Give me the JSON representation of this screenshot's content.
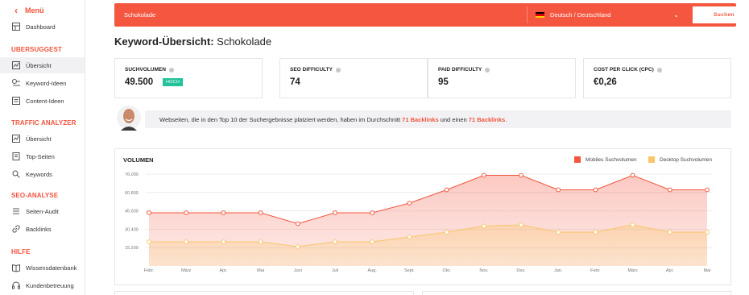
{
  "sidebar": {
    "back_label": "Menü",
    "items_top": [
      {
        "label": "Dashboard",
        "icon": "dashboard-icon"
      }
    ],
    "sections": [
      {
        "title": "UBERSUGGEST",
        "items": [
          {
            "label": "Übersicht",
            "icon": "overview-icon",
            "active": true
          },
          {
            "label": "Keyword-Ideen",
            "icon": "keyword-ideas-icon"
          },
          {
            "label": "Content-Ideen",
            "icon": "content-ideas-icon"
          }
        ]
      },
      {
        "title": "TRAFFIC ANALYZER",
        "items": [
          {
            "label": "Übersicht",
            "icon": "overview-icon"
          },
          {
            "label": "Top-Seiten",
            "icon": "top-pages-icon"
          },
          {
            "label": "Keywords",
            "icon": "keywords-icon"
          }
        ]
      },
      {
        "title": "SEO-ANALYSE",
        "items": [
          {
            "label": "Seiten-Audit",
            "icon": "site-audit-icon"
          },
          {
            "label": "Backlinks",
            "icon": "backlinks-icon"
          }
        ]
      },
      {
        "title": "HILFE",
        "items": [
          {
            "label": "Wissensdatenbank",
            "icon": "knowledge-base-icon"
          },
          {
            "label": "Kundenbetreuung",
            "icon": "support-icon"
          }
        ]
      }
    ]
  },
  "search": {
    "value": "Schokolade",
    "language": "Deutsch / Deutschland",
    "button": "Suchen"
  },
  "page": {
    "title_prefix": "Keyword-Übersicht:",
    "title_keyword": "Schokolade"
  },
  "metrics": [
    {
      "label": "SUCHVOLUMEN",
      "value": "49.500",
      "badge": "HOCH"
    },
    {
      "label": "SEO DIFFICULTY",
      "value": "74"
    },
    {
      "label": "PAID DIFFICULTY",
      "value": "95"
    },
    {
      "label": "COST PER CLICK (CPC)",
      "value": "€0,26"
    }
  ],
  "tip": {
    "text_before": "Webseiten, die in den Top 10 der Suchergebnisse platziert werden, haben im Durchschnitt",
    "highlight1": "71 Backlinks",
    "text_middle": "und einen",
    "highlight2": "71 Backlinks",
    "text_after": "."
  },
  "colors": {
    "accent": "#f4563f",
    "mobile": "#f4563f",
    "desktop": "#f9c66a",
    "badge": "#23c29a"
  },
  "chart_data": {
    "type": "area",
    "title": "VOLUMEN",
    "categories": [
      "Febr.",
      "März",
      "Apr.",
      "Mai",
      "Juni",
      "Juli",
      "Aug.",
      "Sept.",
      "Okt.",
      "Nov.",
      "Dez.",
      "Jan.",
      "Febr.",
      "März",
      "Apr.",
      "Mai"
    ],
    "yticks": [
      "15.200",
      "30.400",
      "45.600",
      "60.800",
      "76.000"
    ],
    "ylim": [
      0,
      76000
    ],
    "grid": true,
    "legend_position": "top-right",
    "series": [
      {
        "name": "Mobiles Suchvolumen",
        "color": "#f4563f",
        "values": [
          44000,
          44000,
          44000,
          44000,
          35000,
          44000,
          44000,
          52000,
          63000,
          75000,
          75000,
          63000,
          63000,
          75000,
          63000,
          63000
        ]
      },
      {
        "name": "Desktop Suchvolumen",
        "color": "#f9c66a",
        "values": [
          20000,
          20000,
          20000,
          20000,
          16000,
          20000,
          20000,
          24000,
          28000,
          33000,
          34000,
          28000,
          28000,
          34000,
          28000,
          28000
        ]
      }
    ]
  }
}
